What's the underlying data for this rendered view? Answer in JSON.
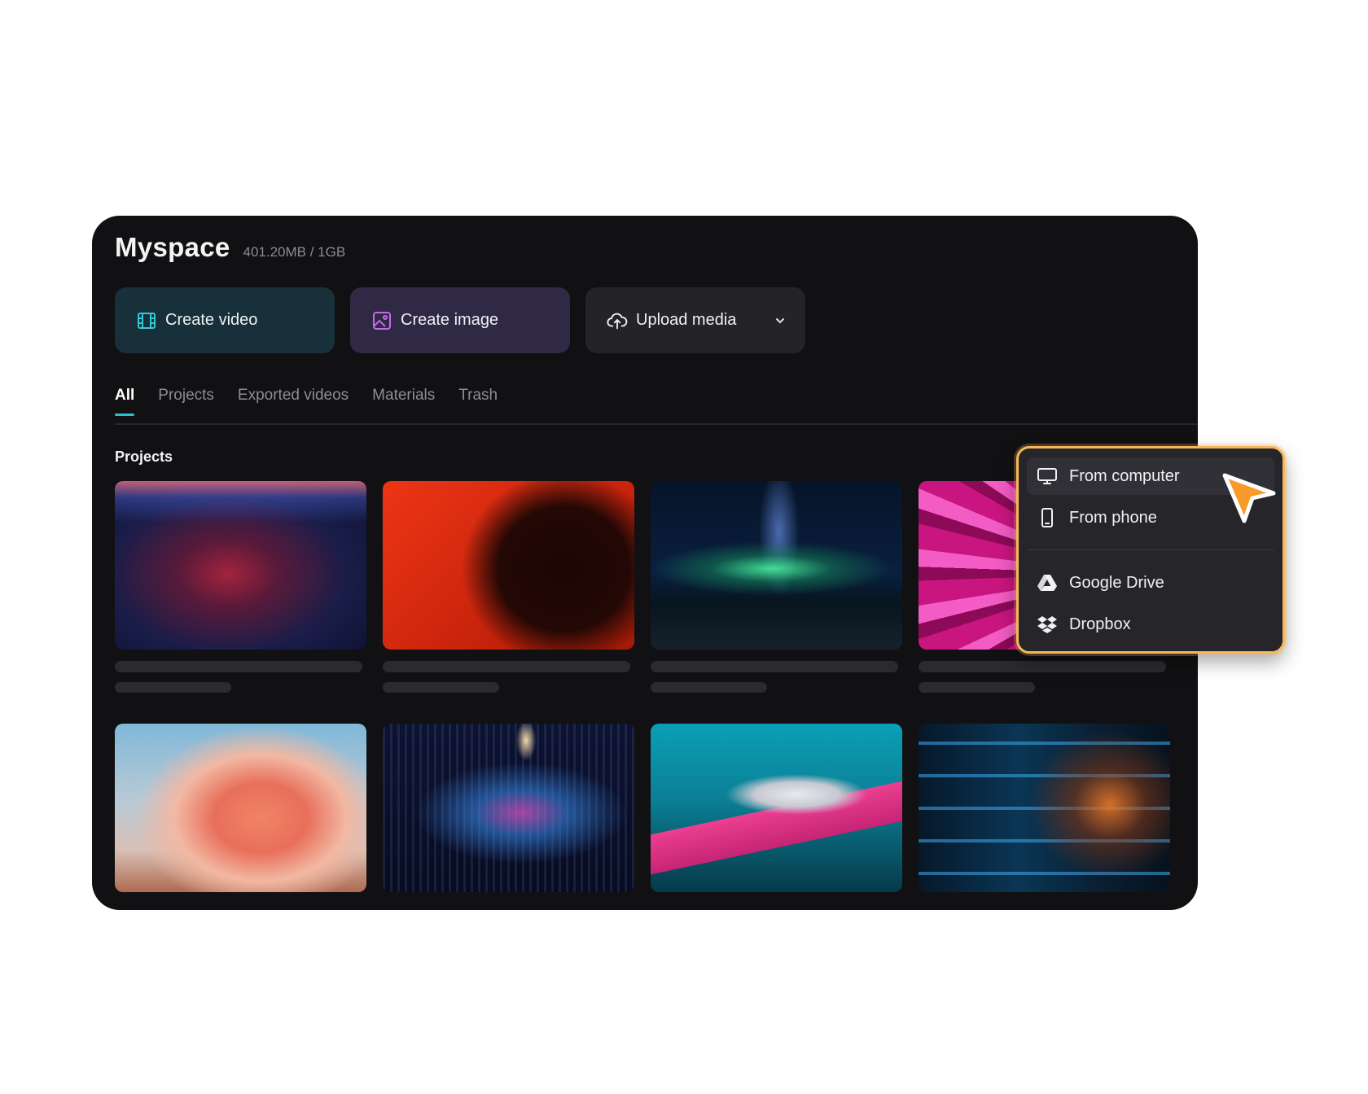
{
  "header": {
    "title": "Myspace",
    "storage": "401.20MB / 1GB"
  },
  "actions": {
    "create_video": "Create video",
    "create_image": "Create image",
    "upload_media": "Upload media"
  },
  "tabs": [
    {
      "label": "All",
      "active": true
    },
    {
      "label": "Projects",
      "active": false
    },
    {
      "label": "Exported videos",
      "active": false
    },
    {
      "label": "Materials",
      "active": false
    },
    {
      "label": "Trash",
      "active": false
    }
  ],
  "section_title": "Projects",
  "upload_menu": {
    "items": [
      {
        "label": "From computer",
        "icon": "monitor-icon",
        "hovered": true
      },
      {
        "label": "From phone",
        "icon": "phone-icon"
      },
      {
        "label": "Google Drive",
        "icon": "google-drive-icon"
      },
      {
        "label": "Dropbox",
        "icon": "dropbox-icon"
      }
    ]
  },
  "colors": {
    "panel_bg": "#111113",
    "tab_accent": "#2bc1cf",
    "menu_border": "#f6b75c",
    "cursor": "#f79a2a"
  }
}
